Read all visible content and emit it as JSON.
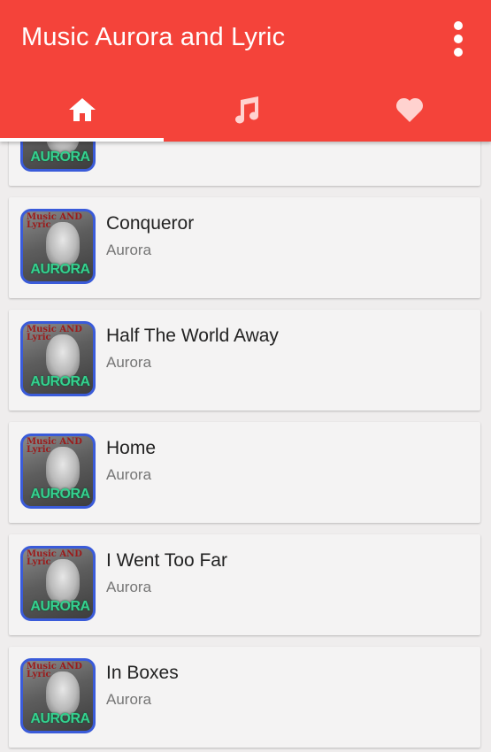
{
  "app": {
    "title": "Music Aurora and Lyric",
    "accent_color": "#f4433a"
  },
  "tabs": [
    {
      "icon": "home-icon",
      "active": true
    },
    {
      "icon": "music-note-icon",
      "active": false
    },
    {
      "icon": "heart-icon",
      "active": false
    }
  ],
  "thumbnail": {
    "top_text": "Music AND Lyric",
    "bottom_text": "AURORA"
  },
  "songs": [
    {
      "title": "",
      "artist": ""
    },
    {
      "title": "Conqueror",
      "artist": "Aurora"
    },
    {
      "title": "Half The World Away",
      "artist": "Aurora"
    },
    {
      "title": "Home",
      "artist": "Aurora"
    },
    {
      "title": "I Went Too Far",
      "artist": "Aurora"
    },
    {
      "title": "In Boxes",
      "artist": "Aurora"
    }
  ]
}
